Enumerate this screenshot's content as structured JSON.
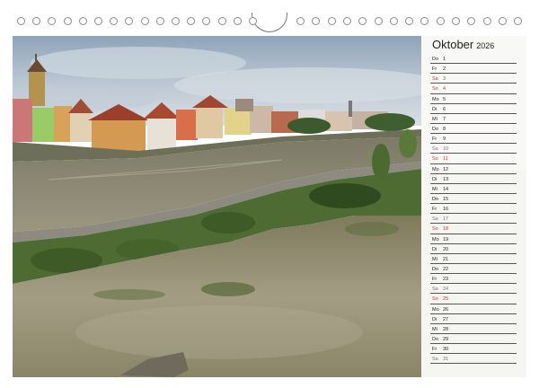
{
  "calendar": {
    "month": "Oktober",
    "year": "2026",
    "days": [
      {
        "wd": "Do",
        "d": "1",
        "type": "weekday"
      },
      {
        "wd": "Fr",
        "d": "2",
        "type": "weekday"
      },
      {
        "wd": "Sa",
        "d": "3",
        "type": "sun"
      },
      {
        "wd": "So",
        "d": "4",
        "type": "sun"
      },
      {
        "wd": "Mo",
        "d": "5",
        "type": "weekday"
      },
      {
        "wd": "Di",
        "d": "6",
        "type": "weekday"
      },
      {
        "wd": "Mi",
        "d": "7",
        "type": "weekday"
      },
      {
        "wd": "Do",
        "d": "8",
        "type": "weekday"
      },
      {
        "wd": "Fr",
        "d": "9",
        "type": "weekday"
      },
      {
        "wd": "Sa",
        "d": "10",
        "type": "sat"
      },
      {
        "wd": "So",
        "d": "11",
        "type": "sun"
      },
      {
        "wd": "Mo",
        "d": "12",
        "type": "weekday"
      },
      {
        "wd": "Di",
        "d": "13",
        "type": "weekday"
      },
      {
        "wd": "Mi",
        "d": "14",
        "type": "weekday"
      },
      {
        "wd": "Do",
        "d": "15",
        "type": "weekday"
      },
      {
        "wd": "Fr",
        "d": "16",
        "type": "weekday"
      },
      {
        "wd": "Sa",
        "d": "17",
        "type": "sat"
      },
      {
        "wd": "So",
        "d": "18",
        "type": "sun"
      },
      {
        "wd": "Mo",
        "d": "19",
        "type": "weekday"
      },
      {
        "wd": "Di",
        "d": "20",
        "type": "weekday"
      },
      {
        "wd": "Mi",
        "d": "21",
        "type": "weekday"
      },
      {
        "wd": "Do",
        "d": "22",
        "type": "weekday"
      },
      {
        "wd": "Fr",
        "d": "23",
        "type": "weekday"
      },
      {
        "wd": "Sa",
        "d": "24",
        "type": "sat"
      },
      {
        "wd": "So",
        "d": "25",
        "type": "sun"
      },
      {
        "wd": "Mo",
        "d": "26",
        "type": "weekday"
      },
      {
        "wd": "Di",
        "d": "27",
        "type": "weekday"
      },
      {
        "wd": "Mi",
        "d": "28",
        "type": "weekday"
      },
      {
        "wd": "Do",
        "d": "29",
        "type": "weekday"
      },
      {
        "wd": "Fr",
        "d": "30",
        "type": "weekday"
      },
      {
        "wd": "Sa",
        "d": "31",
        "type": "sat"
      }
    ]
  },
  "colors": {
    "sunday": "#c0392b",
    "saturday": "#777777",
    "river": "#6e6a52",
    "sky": "#b8c6d3"
  }
}
